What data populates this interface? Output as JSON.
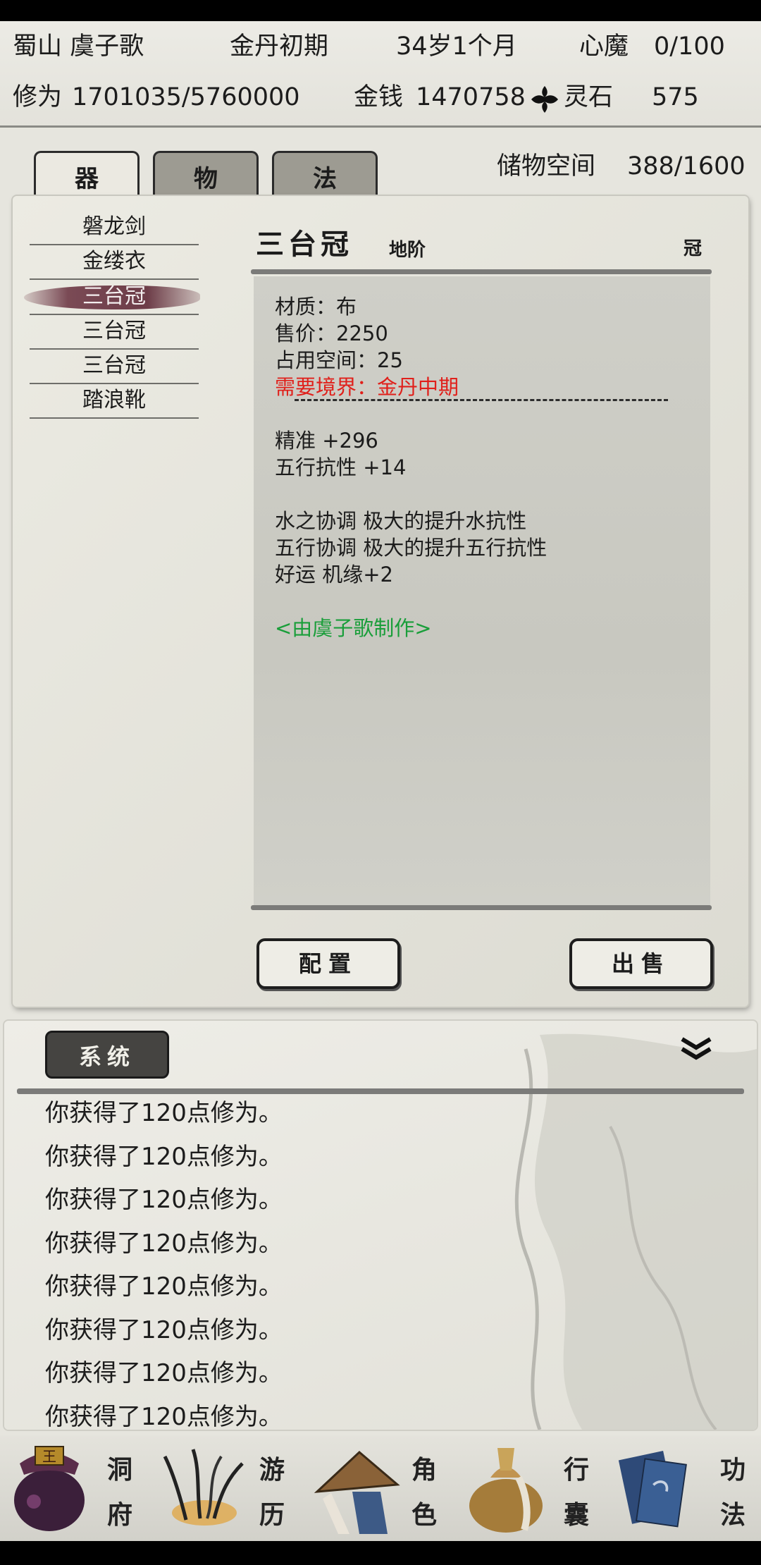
{
  "header": {
    "sect_and_name": "蜀山 虞子歌",
    "realm": "金丹初期",
    "age": "34岁1个月",
    "demon_label": "心魔",
    "demon_value": "0/100",
    "cultivation_label": "修为",
    "cultivation_value": "1701035/5760000",
    "money_label": "金钱",
    "money_value": "1470758",
    "spirit_stone_label": "灵石",
    "spirit_stone_value": "575"
  },
  "tabs": [
    {
      "label": "器",
      "active": true
    },
    {
      "label": "物",
      "active": false
    },
    {
      "label": "法",
      "active": false
    }
  ],
  "storage": {
    "label": "储物空间",
    "value": "388/1600"
  },
  "items": [
    {
      "label": "磐龙剑",
      "selected": false
    },
    {
      "label": "金缕衣",
      "selected": false
    },
    {
      "label": "三台冠",
      "selected": true
    },
    {
      "label": "三台冠",
      "selected": false
    },
    {
      "label": "三台冠",
      "selected": false
    },
    {
      "label": "踏浪靴",
      "selected": false
    }
  ],
  "detail": {
    "name": "三台冠",
    "grade": "地阶",
    "slot": "冠",
    "material": "材质：布",
    "price": "售价：2250",
    "space": "占用空间：25",
    "requirement": "需要境界：金丹中期",
    "stats": [
      "精准 +296",
      "五行抗性 +14"
    ],
    "effects": [
      "水之协调 极大的提升水抗性",
      "五行协调 极大的提升五行抗性",
      "好运 机缘+2"
    ],
    "maker": "<由虞子歌制作>"
  },
  "buttons": {
    "equip": "配置",
    "sell": "出售"
  },
  "log": {
    "tab_label": "系统",
    "lines": [
      "你获得了120点修为。",
      "你获得了120点修为。",
      "你获得了120点修为。",
      "你获得了120点修为。",
      "你获得了120点修为。",
      "你获得了120点修为。",
      "你获得了120点修为。",
      "你获得了120点修为。"
    ]
  },
  "nav": [
    {
      "top": "洞",
      "bottom": "府",
      "icon": "cave-bag-icon"
    },
    {
      "top": "游",
      "bottom": "历",
      "icon": "herb-icon"
    },
    {
      "top": "角",
      "bottom": "色",
      "icon": "straw-hat-icon"
    },
    {
      "top": "行",
      "bottom": "囊",
      "icon": "pouch-icon"
    },
    {
      "top": "功",
      "bottom": "法",
      "icon": "scroll-book-icon"
    }
  ],
  "colors": {
    "requirement": "#e0201b",
    "maker": "#1a9e3a",
    "selected_brush": "#7a4a55"
  }
}
